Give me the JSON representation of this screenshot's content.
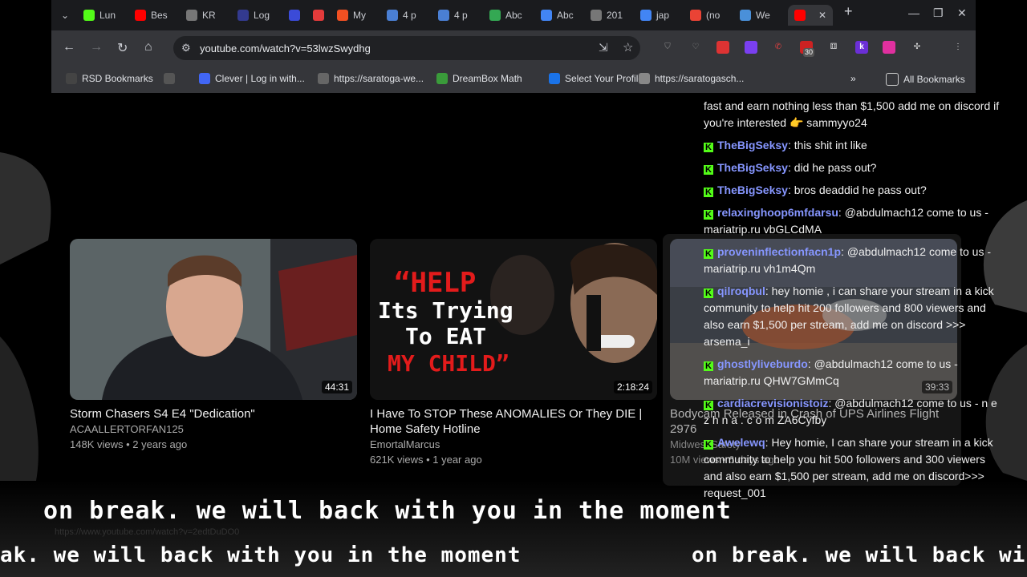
{
  "tabs": [
    {
      "label": "Lun",
      "icon": "kick-icon",
      "color": "#53fc18"
    },
    {
      "label": "Bes",
      "icon": "youtube-icon",
      "color": "#ff0000"
    },
    {
      "label": "KR",
      "icon": "qr-icon",
      "color": "#777777"
    },
    {
      "label": "Log",
      "icon": "logo-icon",
      "color": "#333a8f"
    },
    {
      "label": "",
      "icon": "r-icon",
      "color": "#3b4bd8"
    },
    {
      "label": "",
      "icon": "circle-icon",
      "color": "#e33b3b"
    },
    {
      "label": "My",
      "icon": "microsoft-icon",
      "color": "#f25022"
    },
    {
      "label": "4 p",
      "icon": "doc-icon",
      "color": "#4a7fd4"
    },
    {
      "label": "4 p",
      "icon": "check-icon",
      "color": "#4a7fd4"
    },
    {
      "label": "Abc",
      "icon": "drive-icon",
      "color": "#34a853"
    },
    {
      "label": "Abc",
      "icon": "docs-icon",
      "color": "#4285f4"
    },
    {
      "label": "201",
      "icon": "globe-icon",
      "color": "#777777"
    },
    {
      "label": "jap",
      "icon": "google-icon",
      "color": "#4285f4"
    },
    {
      "label": "(no",
      "icon": "gmail-icon",
      "color": "#ea4335"
    },
    {
      "label": "We",
      "icon": "lock-icon",
      "color": "#4a90d9"
    },
    {
      "label": "",
      "icon": "youtube-icon",
      "color": "#ff0000"
    }
  ],
  "address": {
    "url": "youtube.com/watch?v=53lwzSwydhg"
  },
  "extension_badge": "30",
  "bookmarks": [
    {
      "label": "RSD Bookmarks",
      "icon": "folder-icon"
    },
    {
      "label": "",
      "icon": "apps-icon"
    },
    {
      "label": "Clever | Log in with...",
      "icon": "clever-icon"
    },
    {
      "label": "https://saratoga-we...",
      "icon": "globe-icon"
    },
    {
      "label": "DreamBox Math",
      "icon": "dreambox-icon"
    },
    {
      "label": "Select Your Profile",
      "icon": "e-icon"
    },
    {
      "label": "https://saratogasch...",
      "icon": "pen-icon"
    }
  ],
  "all_bookmarks": "All Bookmarks",
  "videos": [
    {
      "title": "Storm Chasers S4 E4 \"Dedication\"",
      "channel": "ACAALLERTORFAN125",
      "meta": "148K views • 2 years ago",
      "duration": "44:31"
    },
    {
      "title": "I Have To STOP These ANOMALIES Or They DIE | Home Safety Hotline",
      "channel": "EmortalMarcus",
      "meta": "621K views • 1 year ago",
      "duration": "2:18:24",
      "thumb_text_1": "“HELP",
      "thumb_text_2": "Its Trying",
      "thumb_text_3": "To EAT",
      "thumb_text_4": "MY CHILD”"
    },
    {
      "title": "Bodycam Released in Crash of UPS Airlines Flight 2976",
      "channel": "Midwest Safety",
      "meta": "10M views • 6 days ago",
      "duration": "39:33"
    }
  ],
  "chat": {
    "partial_top": "fast and earn nothing less than $1,500 add me on discord if you're interested 👉 sammyyo24",
    "messages": [
      {
        "user": "TheBigSeksy",
        "text": "this shit int like"
      },
      {
        "user": "TheBigSeksy",
        "text": "did he pass out?"
      },
      {
        "user": "TheBigSeksy",
        "text": "bros deaddid he pass out?"
      },
      {
        "user": "relaxinghoop6mfdarsu",
        "text": "@abdulmach12 come to us - mariatrip.ru vbGLCdMA"
      },
      {
        "user": "proveninflectionfacn1p",
        "text": "@abdulmach12 come to us - mariatrip.ru vh1m4Qm"
      },
      {
        "user": "qilroqbul",
        "text": "hey homie , i can share your stream in a kick community to help hit 200 followers and 800 viewers and also earn $1,500 per stream, add me on discord >>> arsema_i"
      },
      {
        "user": "ghostlyliveburdo",
        "text": "@abdulmach12 come to us - mariatrip.ru QHW7GMmCq"
      },
      {
        "user": "cardiacrevisionistoiz",
        "text": "@abdulmach12 come to us - n e z h n a . c o m ZA6Cyfby"
      },
      {
        "user": "Awelewq",
        "text": "Hey homie, I can share your stream in a kick community to help you hit 500 followers and 300 viewers and also earn $1,500 per stream, add me on discord>>> request_001"
      }
    ]
  },
  "ticker": {
    "line1": "on break. we will back with you in the moment",
    "line2a": "ak. we will back with you in the moment",
    "line2b": "on break. we will back wi"
  },
  "ghost_url": "https://www.youtube.com/watch?v=2edtDuDO0"
}
